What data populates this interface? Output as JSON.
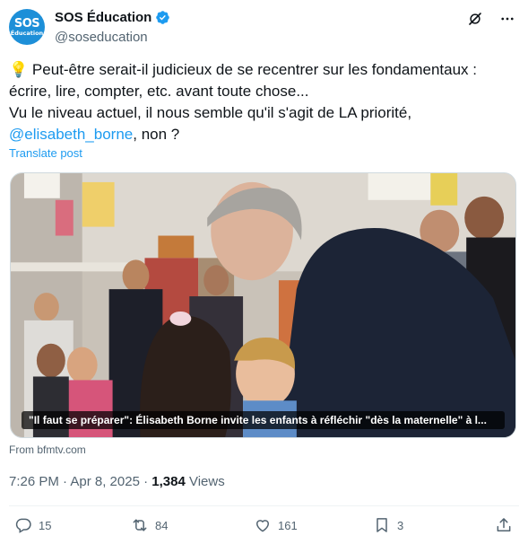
{
  "account": {
    "avatar_line1": "SOS",
    "avatar_line2": "Éducation",
    "name": "SOS Éducation",
    "handle": "@soseducation"
  },
  "tweet": {
    "emoji": "💡",
    "line1": "Peut-être serait-il judicieux de se recentrer sur les fondamentaux : écrire, lire, compter, etc. avant toute chose...",
    "line2_prefix": "Vu le niveau actuel, il nous semble qu'il s'agit de LA priorité,",
    "mention": "@elisabeth_borne",
    "line2_suffix": ", non ?",
    "translate": "Translate post"
  },
  "media": {
    "caption": "\"Il faut se préparer\": Élisabeth Borne invite les enfants à réfléchir \"dès la maternelle\" à l...",
    "source": "From bfmtv.com"
  },
  "meta": {
    "time": "7:26 PM · Apr 8, 2025 · ",
    "views_count": "1,384",
    "views_label": " Views"
  },
  "actions": {
    "replies": "15",
    "reposts": "84",
    "likes": "161",
    "bookmarks": "3"
  },
  "colors": {
    "accent": "#1d9bf0",
    "verified": "#1d9bf0",
    "secondary_text": "#536471"
  }
}
